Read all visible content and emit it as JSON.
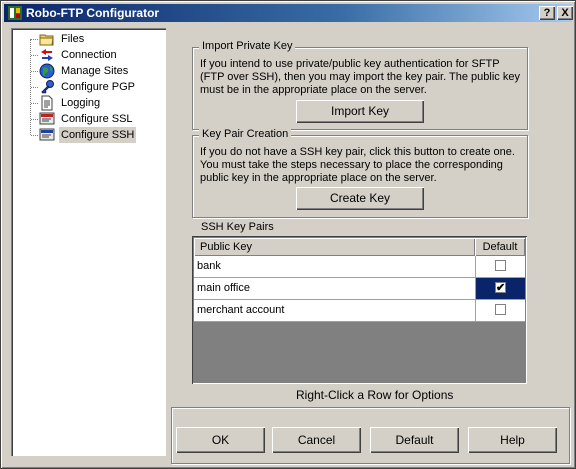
{
  "window": {
    "title": "Robo-FTP Configurator",
    "help_btn": "?",
    "close_btn": "X"
  },
  "tree": {
    "items": [
      {
        "label": "Files",
        "icon": "folder-icon"
      },
      {
        "label": "Connection",
        "icon": "connection-icon"
      },
      {
        "label": "Manage Sites",
        "icon": "globe-icon"
      },
      {
        "label": "Configure PGP",
        "icon": "key-icon"
      },
      {
        "label": "Logging",
        "icon": "document-icon"
      },
      {
        "label": "Configure SSL",
        "icon": "certificate-icon"
      },
      {
        "label": "Configure SSH",
        "icon": "terminal-icon"
      }
    ],
    "selected": "Configure SSH"
  },
  "import": {
    "title": "Import Private Key",
    "text": "If you intend to use private/public key authentication for SFTP (FTP over SSH), then you may import the key pair. The public key must be in the appropriate place on the server.",
    "button": "Import Key"
  },
  "create": {
    "title": "Key Pair Creation",
    "text": "If you do not have a SSH key pair, click this button to create one. You must take the steps necessary to place the corresponding public key in the appropriate place on the server.",
    "button": "Create Key"
  },
  "keys": {
    "label": "SSH Key Pairs",
    "columns": [
      "Public Key",
      "Default"
    ],
    "rows": [
      {
        "name": "bank",
        "default": false,
        "check": ""
      },
      {
        "name": "main office",
        "default": true,
        "check": "✔"
      },
      {
        "name": "merchant account",
        "default": false,
        "check": ""
      }
    ],
    "hint": "Right-Click a Row for Options"
  },
  "buttons": {
    "ok": "OK",
    "cancel": "Cancel",
    "default": "Default",
    "help": "Help"
  },
  "colors": {
    "title_bar": "#0a246a",
    "selection": "#0a246a",
    "face": "#d4d0c8"
  }
}
